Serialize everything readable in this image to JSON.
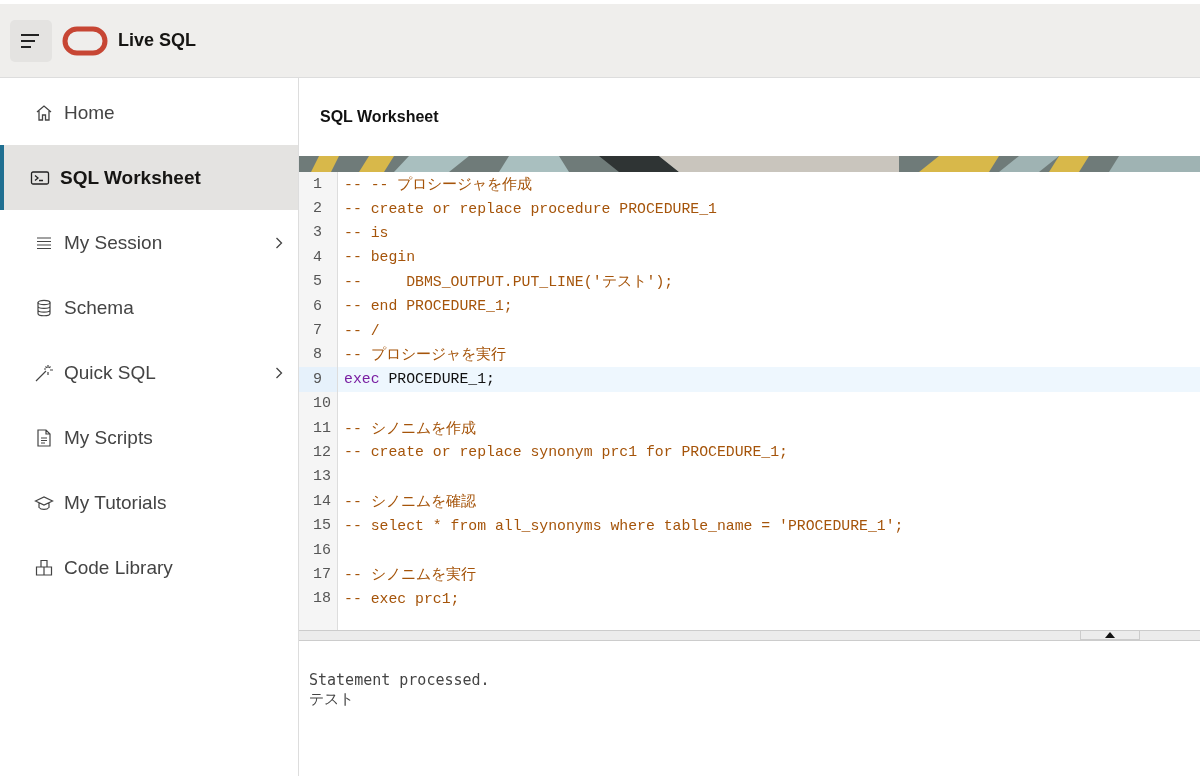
{
  "header": {
    "title": "Live SQL"
  },
  "sidebar": {
    "items": [
      {
        "label": "Home",
        "kind": "home",
        "selected": false,
        "has_submenu": false
      },
      {
        "label": "SQL Worksheet",
        "kind": "terminal",
        "selected": true,
        "has_submenu": false
      },
      {
        "label": "My Session",
        "kind": "list",
        "selected": false,
        "has_submenu": true
      },
      {
        "label": "Schema",
        "kind": "database",
        "selected": false,
        "has_submenu": false
      },
      {
        "label": "Quick SQL",
        "kind": "wand",
        "selected": false,
        "has_submenu": true
      },
      {
        "label": "My Scripts",
        "kind": "document",
        "selected": false,
        "has_submenu": false
      },
      {
        "label": "My Tutorials",
        "kind": "graduation",
        "selected": false,
        "has_submenu": false
      },
      {
        "label": "Code Library",
        "kind": "library",
        "selected": false,
        "has_submenu": false
      }
    ]
  },
  "page": {
    "title": "SQL Worksheet"
  },
  "editor": {
    "lines": [
      {
        "number": "1",
        "active": false,
        "tokens": [
          {
            "kind": "comment",
            "text": "-- -- プロシージャを作成"
          }
        ]
      },
      {
        "number": "2",
        "active": false,
        "tokens": [
          {
            "kind": "comment",
            "text": "-- create or replace procedure PROCEDURE_1"
          }
        ]
      },
      {
        "number": "3",
        "active": false,
        "tokens": [
          {
            "kind": "comment",
            "text": "-- is"
          }
        ]
      },
      {
        "number": "4",
        "active": false,
        "tokens": [
          {
            "kind": "comment",
            "text": "-- begin"
          }
        ]
      },
      {
        "number": "5",
        "active": false,
        "tokens": [
          {
            "kind": "comment",
            "text": "--     DBMS_OUTPUT.PUT_LINE('テスト');"
          }
        ]
      },
      {
        "number": "6",
        "active": false,
        "tokens": [
          {
            "kind": "comment",
            "text": "-- end PROCEDURE_1;"
          }
        ]
      },
      {
        "number": "7",
        "active": false,
        "tokens": [
          {
            "kind": "comment",
            "text": "-- /"
          }
        ]
      },
      {
        "number": "8",
        "active": false,
        "tokens": [
          {
            "kind": "comment",
            "text": "-- プロシージャを実行"
          }
        ]
      },
      {
        "number": "9",
        "active": true,
        "tokens": [
          {
            "kind": "keyword",
            "text": "exec"
          },
          {
            "kind": "plain",
            "text": " PROCEDURE_1;"
          }
        ]
      },
      {
        "number": "10",
        "active": false
      },
      {
        "number": "11",
        "active": false,
        "tokens": [
          {
            "kind": "comment",
            "text": "-- シノニムを作成"
          }
        ]
      },
      {
        "number": "12",
        "active": false,
        "tokens": [
          {
            "kind": "comment",
            "text": "-- create or replace synonym prc1 for PROCEDURE_1;"
          }
        ]
      },
      {
        "number": "13",
        "active": false
      },
      {
        "number": "14",
        "active": false,
        "tokens": [
          {
            "kind": "comment",
            "text": "-- シノニムを確認"
          }
        ]
      },
      {
        "number": "15",
        "active": false,
        "tokens": [
          {
            "kind": "comment",
            "text": "-- select * from all_synonyms where table_name = 'PROCEDURE_1';"
          }
        ]
      },
      {
        "number": "16",
        "active": false
      },
      {
        "number": "17",
        "active": false,
        "tokens": [
          {
            "kind": "comment",
            "text": "-- シノニムを実行"
          }
        ]
      },
      {
        "number": "18",
        "active": false,
        "tokens": [
          {
            "kind": "comment",
            "text": "-- exec prc1;"
          }
        ]
      }
    ]
  },
  "output": {
    "lines": [
      "Statement processed.",
      "テスト"
    ]
  }
}
